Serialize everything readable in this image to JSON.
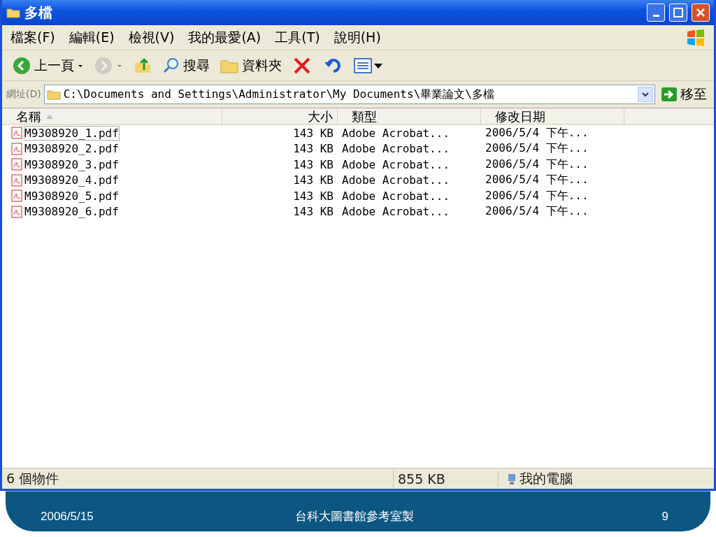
{
  "window": {
    "title": "多檔"
  },
  "menu": [
    "檔案(F)",
    "編輯(E)",
    "檢視(V)",
    "我的最愛(A)",
    "工具(T)",
    "說明(H)"
  ],
  "toolbar": [
    {
      "kind": "back",
      "label": "上一頁",
      "disabled": false
    },
    {
      "kind": "forward",
      "disabled": true
    },
    {
      "kind": "up",
      "disabled": false
    },
    {
      "kind": "search",
      "label": "搜尋",
      "disabled": false
    },
    {
      "kind": "folders",
      "label": "資料夾",
      "disabled": false
    },
    {
      "kind": "delete",
      "disabled": false
    },
    {
      "kind": "undo",
      "disabled": false
    },
    {
      "kind": "views",
      "disabled": false
    }
  ],
  "address": {
    "label": "網址(D)",
    "value": "C:\\Documents and Settings\\Administrator\\My Documents\\畢業論文\\多檔",
    "go": "移至"
  },
  "table": {
    "columns": [
      "名稱",
      "大小",
      "類型",
      "修改日期"
    ],
    "rows": [
      {
        "name": "M9308920_1.pdf",
        "size": "143 KB",
        "type": "Adobe Acrobat...",
        "modified": "2006/5/4 下午...",
        "focused": true
      },
      {
        "name": "M9308920_2.pdf",
        "size": "143 KB",
        "type": "Adobe Acrobat...",
        "modified": "2006/5/4 下午...",
        "focused": false
      },
      {
        "name": "M9308920_3.pdf",
        "size": "143 KB",
        "type": "Adobe Acrobat...",
        "modified": "2006/5/4 下午...",
        "focused": false
      },
      {
        "name": "M9308920_4.pdf",
        "size": "143 KB",
        "type": "Adobe Acrobat...",
        "modified": "2006/5/4 下午...",
        "focused": false
      },
      {
        "name": "M9308920_5.pdf",
        "size": "143 KB",
        "type": "Adobe Acrobat...",
        "modified": "2006/5/4 下午...",
        "focused": false
      },
      {
        "name": "M9308920_6.pdf",
        "size": "143 KB",
        "type": "Adobe Acrobat...",
        "modified": "2006/5/4 下午...",
        "focused": false
      }
    ]
  },
  "status_bar": {
    "count": "6 個物件",
    "size": "855 KB",
    "location": "我的電腦"
  },
  "slide_footer": {
    "date": "2006/5/15",
    "center": "台科大圖書館參考室製",
    "page": "9"
  }
}
